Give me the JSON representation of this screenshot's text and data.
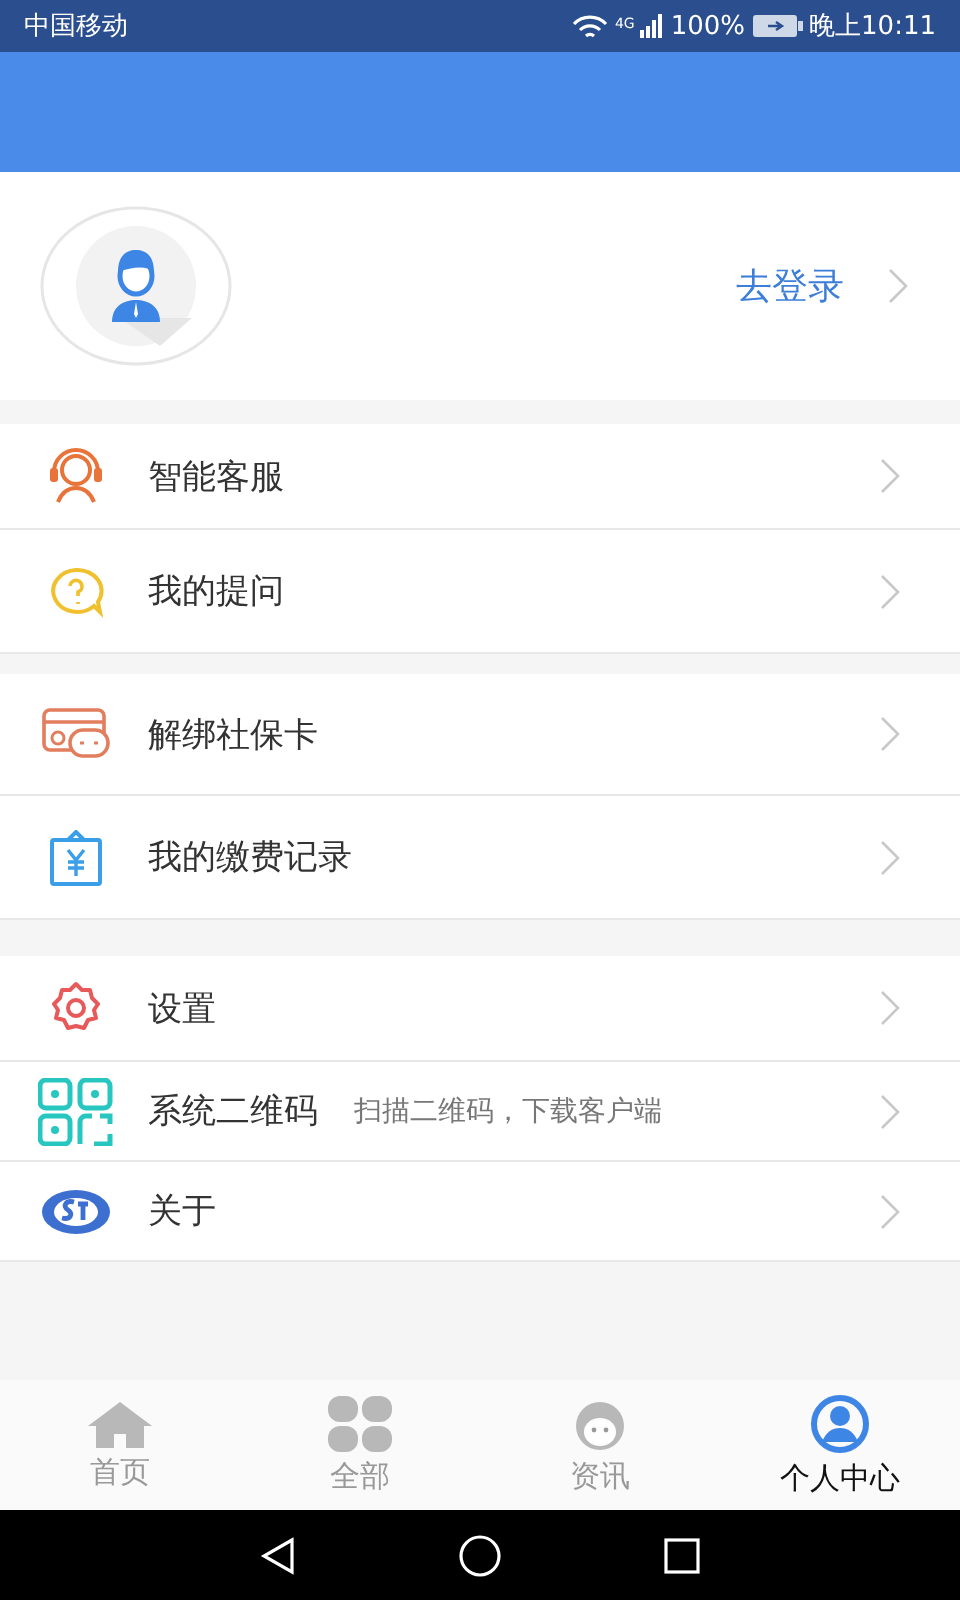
{
  "status_bar": {
    "carrier": "中国移动",
    "network": "4G",
    "battery": "100%",
    "time": "晚上10:11"
  },
  "profile": {
    "login_link": "去登录"
  },
  "menu_groups": [
    {
      "items": [
        {
          "label": "智能客服"
        },
        {
          "label": "我的提问"
        }
      ]
    },
    {
      "items": [
        {
          "label": "解绑社保卡"
        },
        {
          "label": "我的缴费记录"
        }
      ]
    },
    {
      "items": [
        {
          "label": "设置"
        },
        {
          "label": "系统二维码",
          "hint": "扫描二维码，下载客户端"
        },
        {
          "label": "关于"
        }
      ]
    }
  ],
  "tabs": [
    {
      "label": "首页",
      "selected": false
    },
    {
      "label": "全部",
      "selected": false
    },
    {
      "label": "资讯",
      "selected": false
    },
    {
      "label": "个人中心",
      "selected": true
    }
  ]
}
